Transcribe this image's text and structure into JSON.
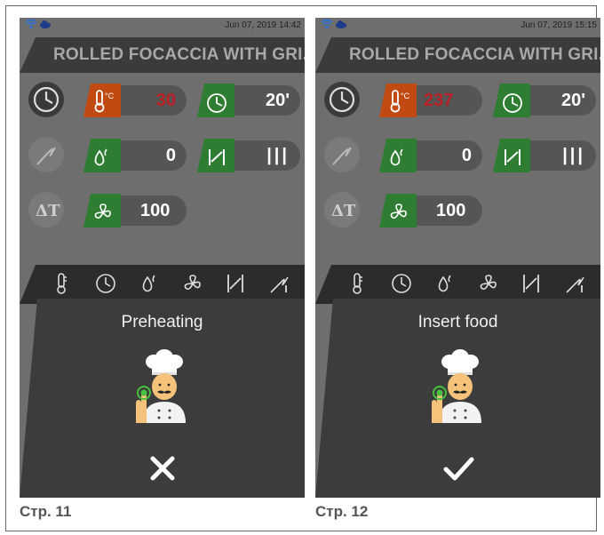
{
  "screens": [
    {
      "datetime": "Jun 07, 2019 14:42",
      "title": "ROLLED FOCACCIA WITH GRI...",
      "temperature": "30",
      "temperature_color": "#b81e24",
      "time": "20'",
      "humidity": "0",
      "damper": "|||",
      "fan": "100",
      "message": "Preheating",
      "action_icon": "close-icon",
      "caption": "Стр. 11"
    },
    {
      "datetime": "Jun 07, 2019 15:15",
      "title": "ROLLED FOCACCIA WITH GRI...",
      "temperature": "237",
      "temperature_color": "#b81e24",
      "time": "20'",
      "humidity": "0",
      "damper": "|||",
      "fan": "100",
      "message": "Insert food",
      "action_icon": "check-icon",
      "caption": "Стр. 12"
    }
  ],
  "icons": {
    "mode_icons": [
      "clock-icon",
      "probe-icon",
      "delta-t-icon"
    ],
    "tabs": [
      "thermometer-tab-icon",
      "clock-tab-icon",
      "humidity-tab-icon",
      "fan-tab-icon",
      "damper-tab-icon",
      "probe-tab-icon"
    ]
  },
  "colors": {
    "green_badge": "#2e7d32",
    "orange_badge": "#c04a12",
    "panel": "#3c3c3c",
    "screen_bg": "#6e6e6e"
  }
}
